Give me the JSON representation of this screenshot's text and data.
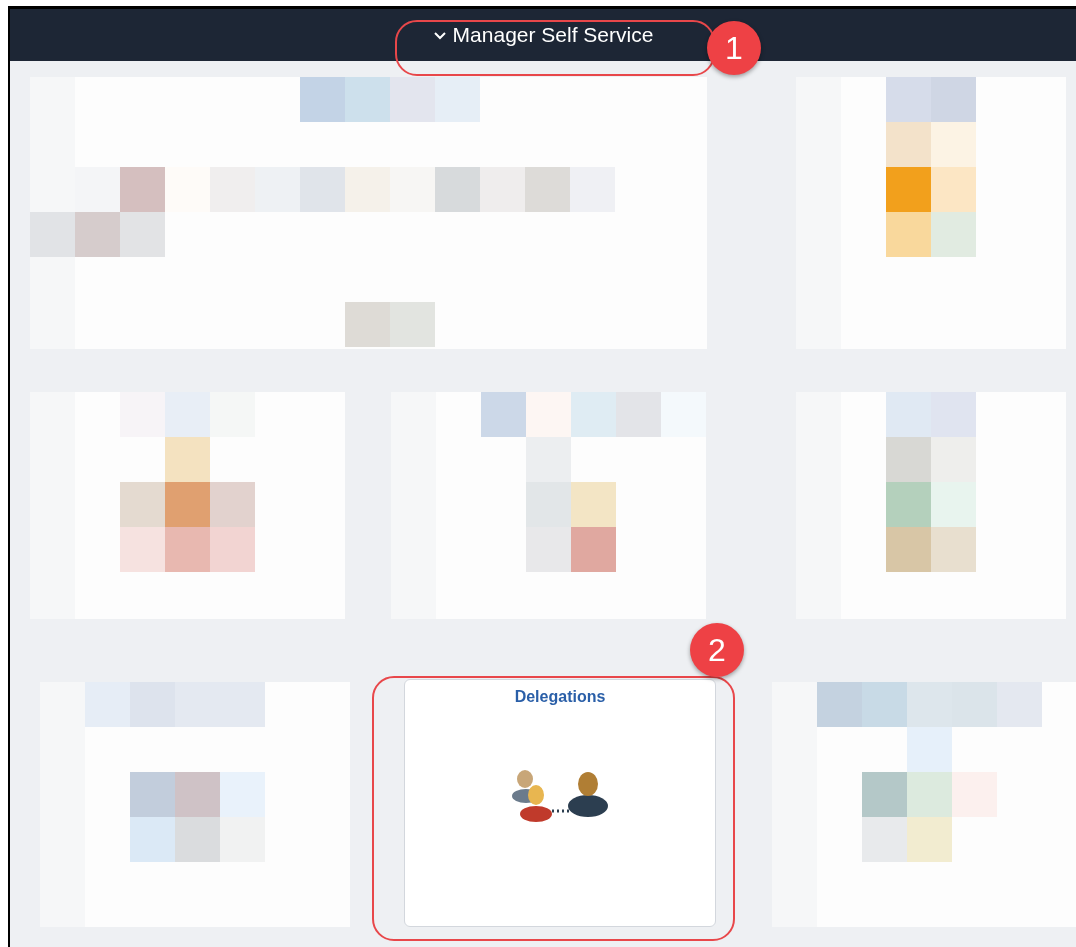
{
  "header": {
    "title": "Manager Self Service",
    "expanded": true
  },
  "tile_rows": [
    {
      "tiles": [
        {
          "kind": "redacted"
        },
        {
          "kind": "redacted"
        }
      ]
    },
    {
      "tiles": [
        {
          "kind": "redacted"
        },
        {
          "kind": "redacted"
        },
        {
          "kind": "redacted"
        }
      ]
    },
    {
      "tiles": [
        {
          "kind": "redacted"
        },
        {
          "kind": "tile",
          "title": "Delegations"
        },
        {
          "kind": "redacted"
        }
      ]
    }
  ],
  "callouts": [
    {
      "label": "1"
    },
    {
      "label": "2"
    }
  ]
}
